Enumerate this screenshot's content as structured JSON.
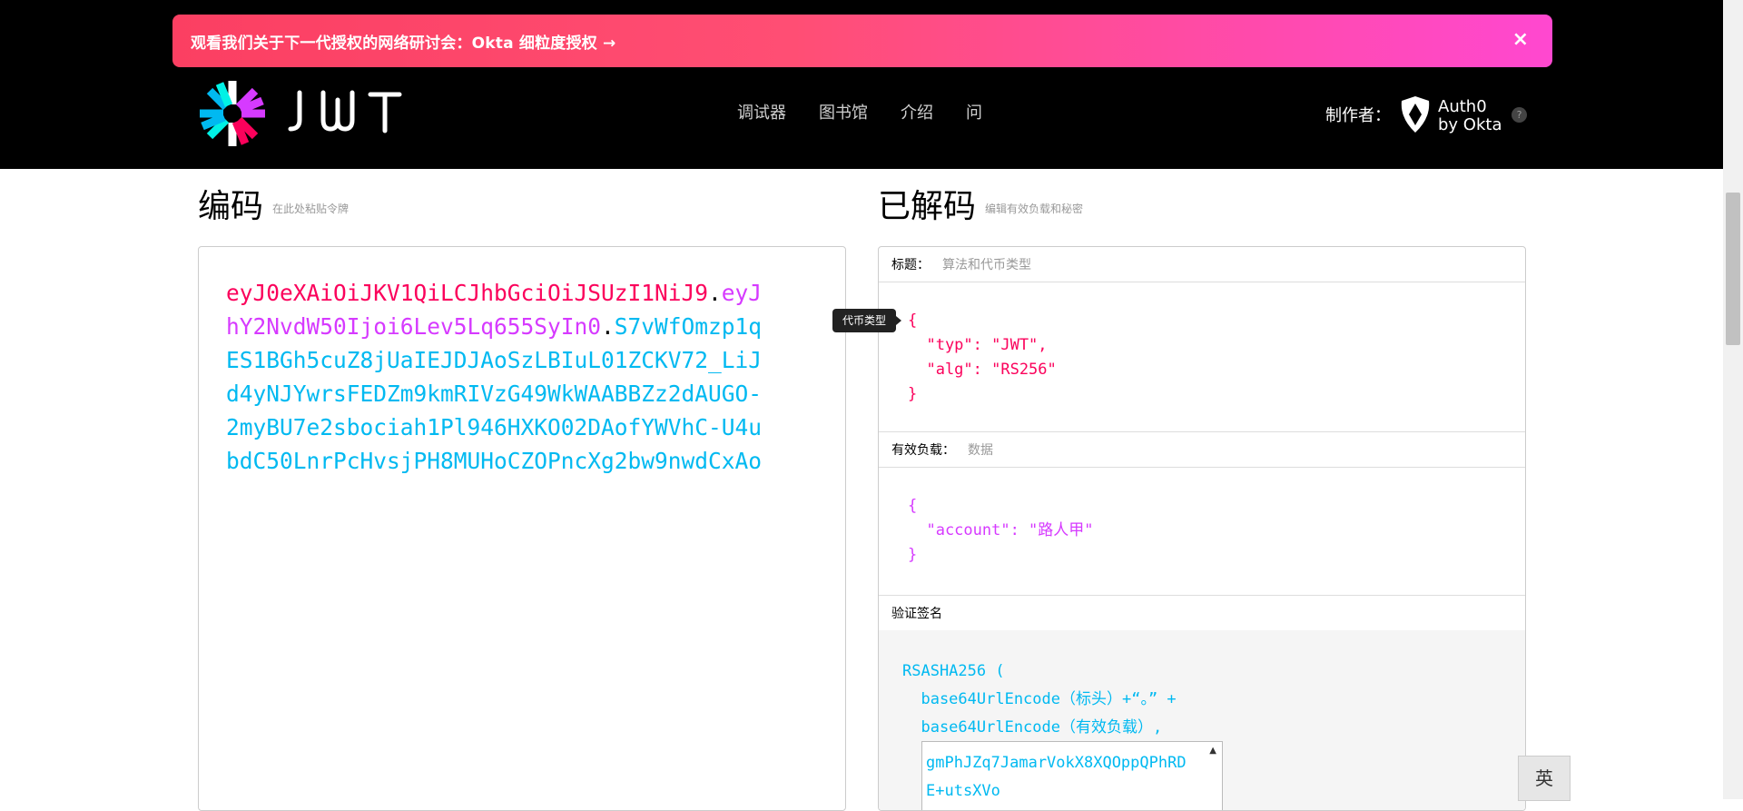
{
  "banner": {
    "text": "观看我们关于下一代授权的网络研讨会：Okta 细粒度授权 →",
    "close_glyph": "×"
  },
  "header": {
    "nav": [
      "调试器",
      "图书馆",
      "介绍",
      "问"
    ],
    "made_by": "制作者：",
    "auth0_line1": "Auth0",
    "auth0_line2": "by Okta",
    "help": "?"
  },
  "encoded": {
    "title": "编码",
    "subtitle": "在此处粘贴令牌",
    "header_part": "eyJ0eXAiOiJKV1QiLCJhbGciOiJSUzI1NiJ9",
    "payload_part": "eyJhY2NvdW50Ijoi6Lev5Lq655SyIn0",
    "signature_part": "S7vWfOmzp1qES1BGh5cuZ8jUaIEJDJAoSzLBIuL01ZCKV72_LiJd4yNJYwrsFEDZm9kmRIVzG49WkWAABBZz2dAUGO-2myBU7e2sbociah1Pl946HXKO02DAofYWVhC-U4ubdC50LnrPcHvsjPH8MUHoCZOPncXg2bw9nwdCxAo",
    "dot": "."
  },
  "decoded": {
    "title": "已解码",
    "subtitle": "编辑有效负载和秘密",
    "header_label": "标题：",
    "header_sub": "算法和代币类型",
    "header_json": "{\n  \"typ\": \"JWT\",\n  \"alg\": \"RS256\"\n}",
    "payload_label": "有效负载：",
    "payload_sub": "数据",
    "payload_json": "{\n  \"account\": \"路人甲\"\n}",
    "verify_label": "验证签名",
    "sig_lines": "RSASHA256 (\n  base64UrlEncode（标头）+“。” +\n  base64UrlEncode（有效负载）,",
    "key_text": "gmPhJZq7JamarVokX8XQOppQPhRD\nE+utsXVo",
    "key_scroll": "▲"
  },
  "tooltip": "代币类型",
  "ime": "英",
  "colors": {
    "header": "#fb015b",
    "payload": "#d63aff",
    "signature": "#00b9f1"
  }
}
